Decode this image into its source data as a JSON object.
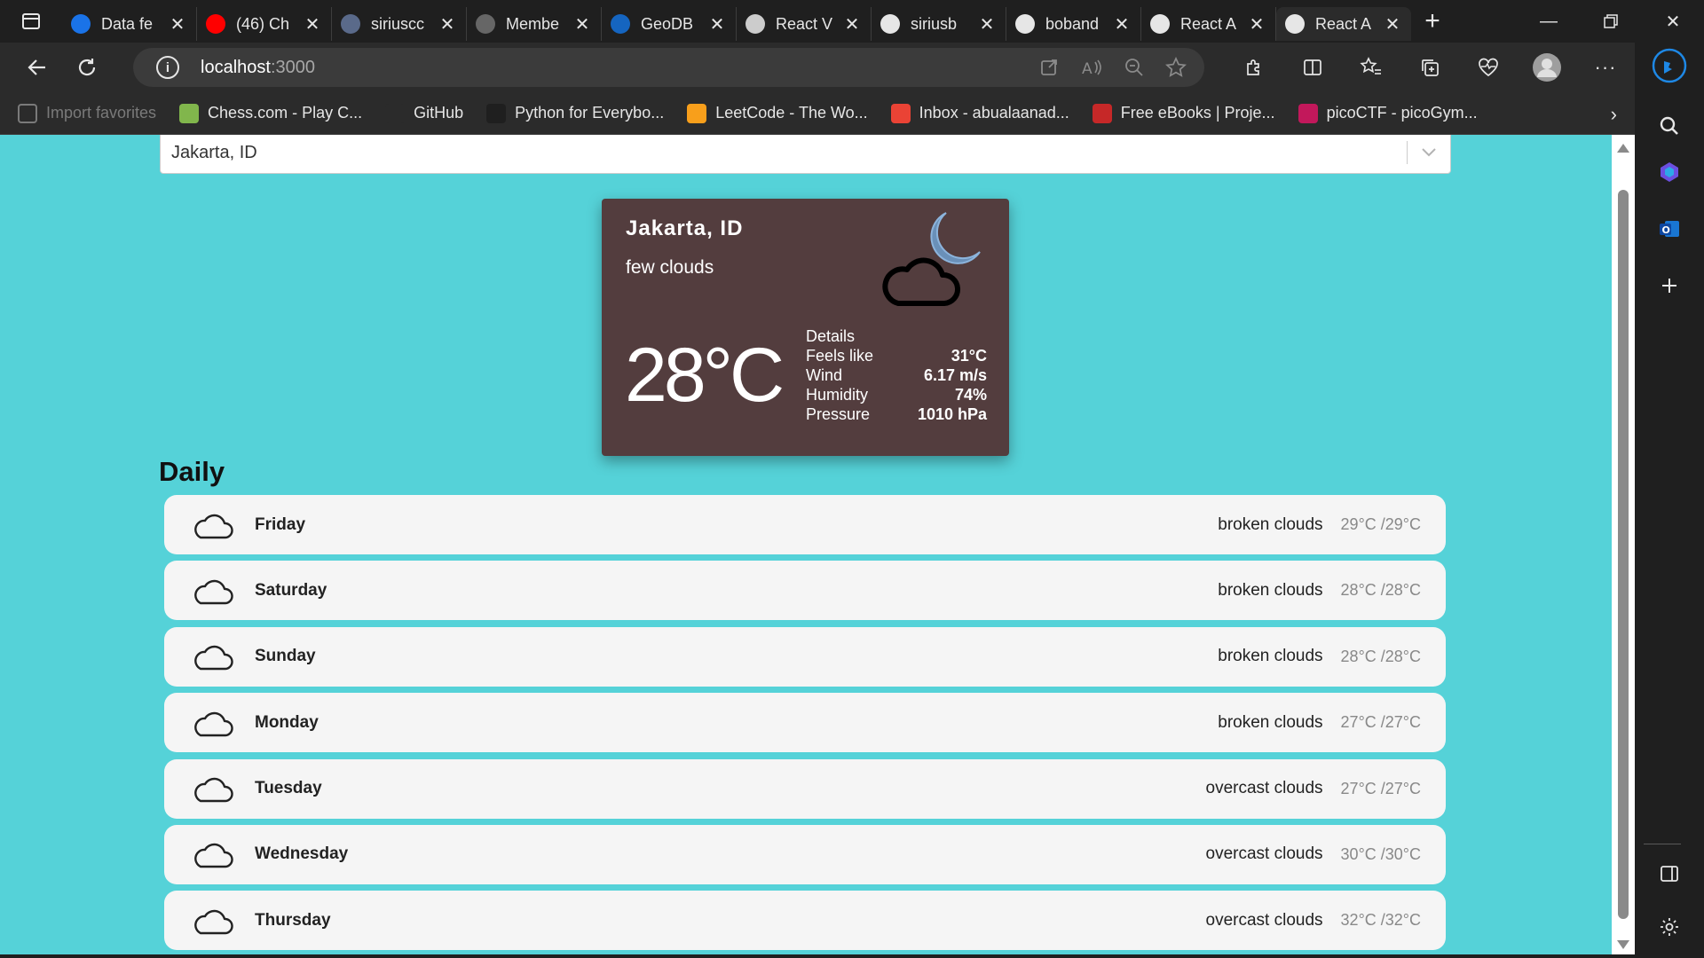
{
  "browser": {
    "tabs": [
      {
        "title": "Data fe",
        "icon": "c-logo-icon",
        "color": "#1a73e8"
      },
      {
        "title": "(46) Ch",
        "icon": "youtube-icon",
        "color": "#ff0000"
      },
      {
        "title": "siriuscc",
        "icon": "image-icon",
        "color": "#5a6a8a"
      },
      {
        "title": "Membe",
        "icon": "globe-icon",
        "color": "#666666"
      },
      {
        "title": "GeoDB",
        "icon": "geodb-icon",
        "color": "#1565c0"
      },
      {
        "title": "React V",
        "icon": "openai-icon",
        "color": "#cccccc"
      },
      {
        "title": "siriusb",
        "icon": "github-icon",
        "color": "#e6e6e6"
      },
      {
        "title": "boband",
        "icon": "github-icon",
        "color": "#e6e6e6"
      },
      {
        "title": "React A",
        "icon": "react-icon",
        "color": "#e6e6e6"
      },
      {
        "title": "React A",
        "icon": "react-icon",
        "color": "#e6e6e6",
        "active": true
      }
    ],
    "address": {
      "host": "localhost",
      "port": ":3000"
    },
    "favorites": [
      {
        "label": "Import favorites",
        "icon": "import-icon",
        "dim": true
      },
      {
        "label": "Chess.com - Play C...",
        "icon": "chess-icon",
        "color": "#81b64c"
      },
      {
        "label": "GitHub",
        "icon": "folder-icon",
        "color": "#2b2b2b"
      },
      {
        "label": "Python for Everybo...",
        "icon": "python-icon",
        "color": "#1f1f1f"
      },
      {
        "label": "LeetCode - The Wo...",
        "icon": "leetcode-icon",
        "color": "#f89f1b"
      },
      {
        "label": "Inbox - abualaanad...",
        "icon": "gmail-icon",
        "color": "#ea4335"
      },
      {
        "label": "Free eBooks | Proje...",
        "icon": "ebook-icon",
        "color": "#c62828"
      },
      {
        "label": "picoCTF - picoGym...",
        "icon": "picoctf-icon",
        "color": "#c2185b"
      }
    ]
  },
  "search": {
    "value": "Jakarta, ID"
  },
  "current": {
    "city": "Jakarta, ID",
    "description": "few clouds",
    "temperature": "28°C",
    "details_title": "Details",
    "details": [
      {
        "label": "Feels like",
        "value": "31°C"
      },
      {
        "label": "Wind",
        "value": "6.17 m/s"
      },
      {
        "label": "Humidity",
        "value": "74%"
      },
      {
        "label": "Pressure",
        "value": "1010 hPa"
      }
    ]
  },
  "daily": {
    "title": "Daily",
    "days": [
      {
        "day": "Friday",
        "description": "broken clouds",
        "temps": "29°C /29°C"
      },
      {
        "day": "Saturday",
        "description": "broken clouds",
        "temps": "28°C /28°C"
      },
      {
        "day": "Sunday",
        "description": "broken clouds",
        "temps": "28°C /28°C"
      },
      {
        "day": "Monday",
        "description": "broken clouds",
        "temps": "27°C /27°C"
      },
      {
        "day": "Tuesday",
        "description": "overcast clouds",
        "temps": "27°C /27°C"
      },
      {
        "day": "Wednesday",
        "description": "overcast clouds",
        "temps": "30°C /30°C"
      },
      {
        "day": "Thursday",
        "description": "overcast clouds",
        "temps": "32°C /32°C"
      }
    ]
  },
  "colors": {
    "page_background": "#55d2d8",
    "card_background": "#533d3e",
    "day_row_background": "#f5f5f5",
    "browser_dark": "#2b2b2b"
  }
}
